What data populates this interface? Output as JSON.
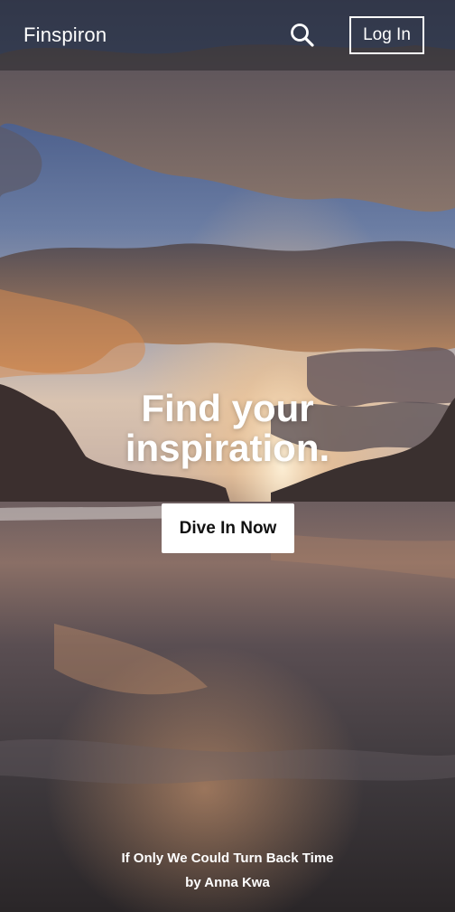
{
  "header": {
    "brand": "Finspiron",
    "search_icon": "search-icon",
    "login_label": "Log In"
  },
  "hero": {
    "title_line1": "Find your",
    "title_line2": "inspiration.",
    "cta_label": "Dive In Now"
  },
  "credit": {
    "photo_title": "If Only We Could Turn Back Time",
    "author_line": "by Anna Kwa"
  },
  "colors": {
    "text": "#ffffff",
    "button_bg": "#ffffff",
    "button_text": "#111111",
    "topbar_overlay": "#28282c"
  }
}
